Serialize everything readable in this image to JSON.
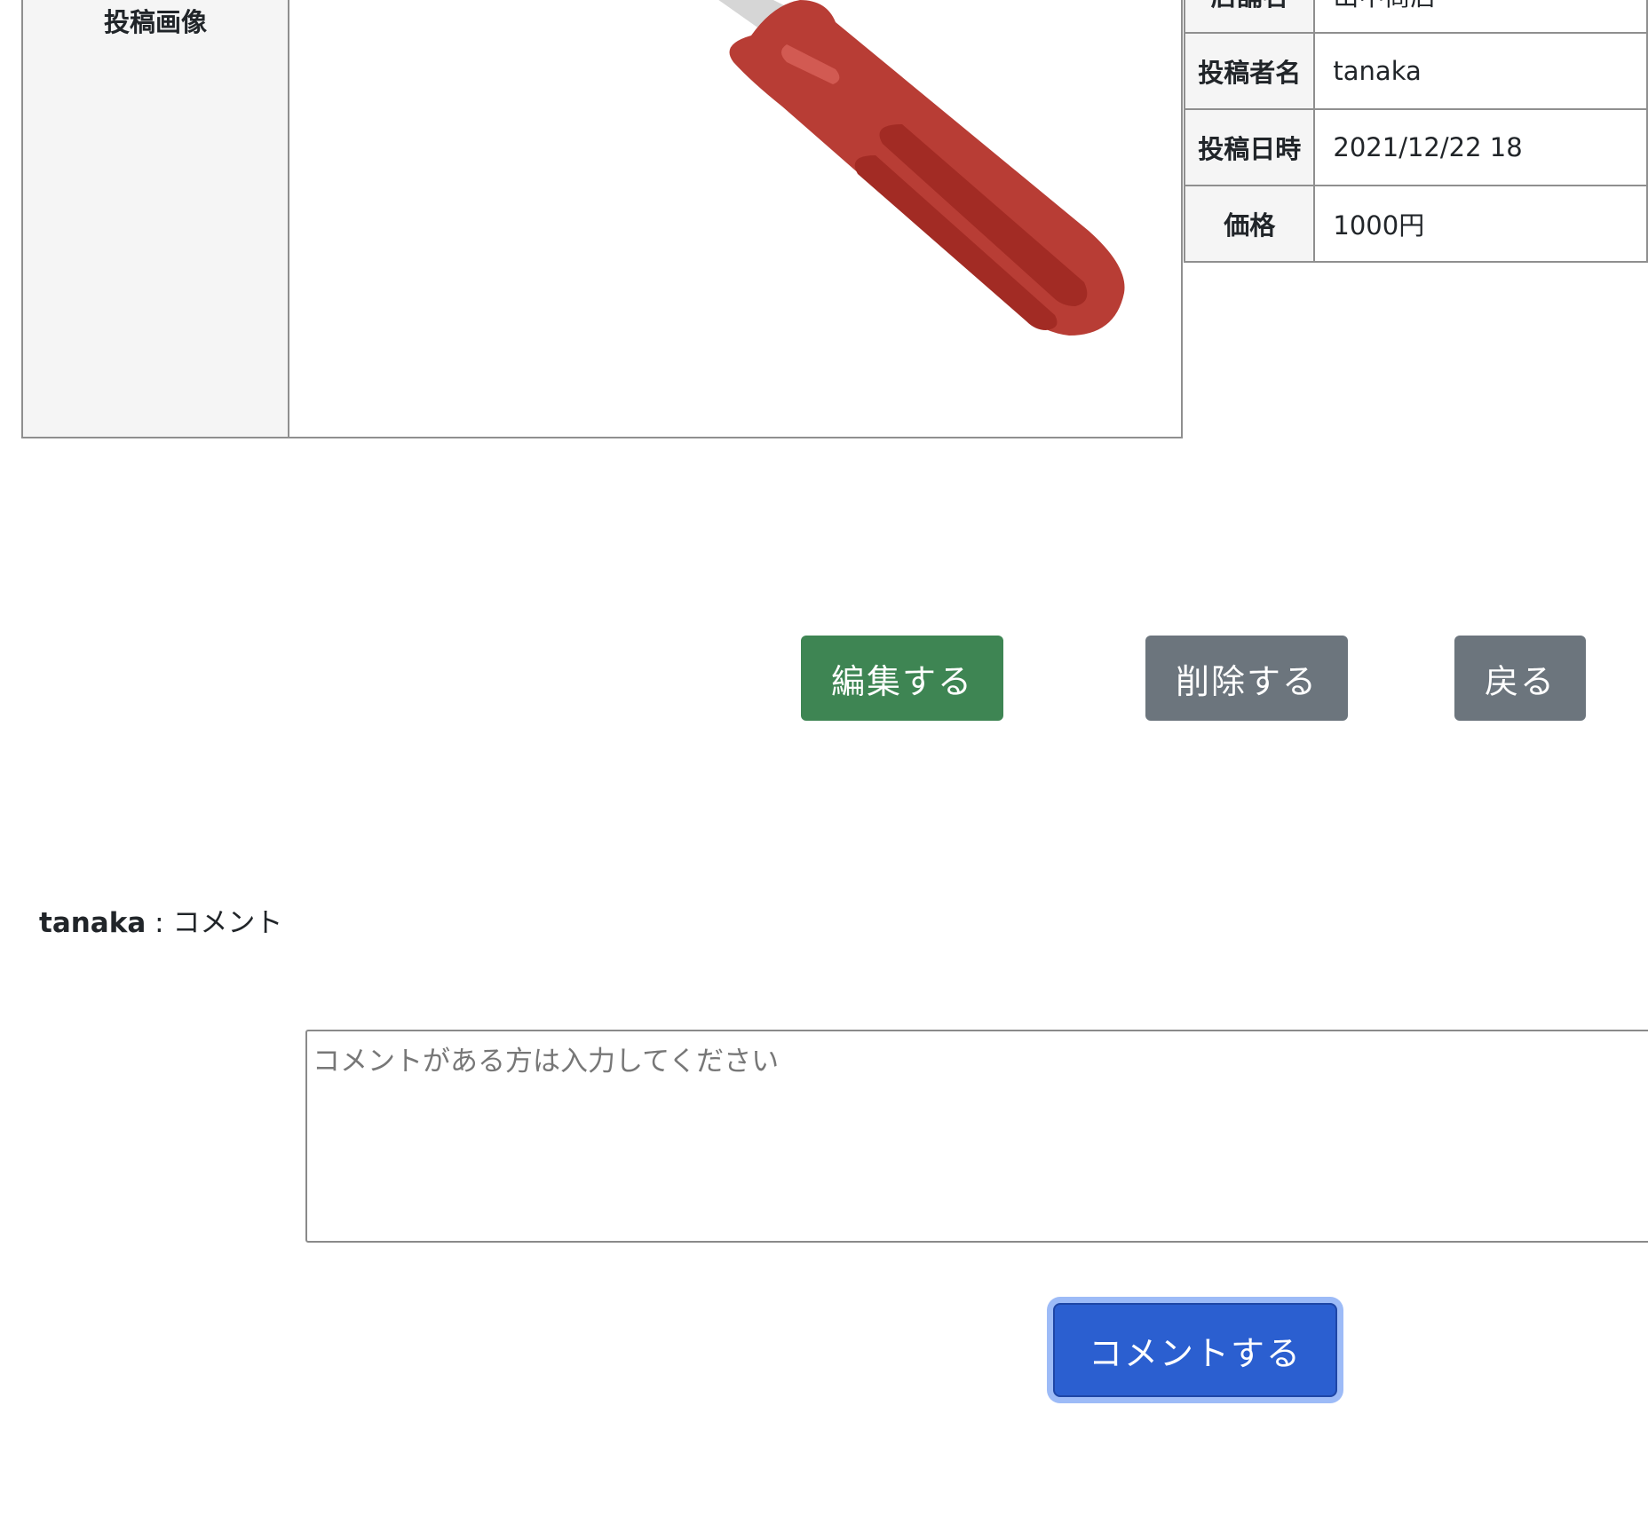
{
  "image_table": {
    "header": "投稿画像",
    "image_icon": "screwdriver-image"
  },
  "info_table": {
    "rows": [
      {
        "label": "店舗名",
        "value": "山中商店"
      },
      {
        "label": "投稿者名",
        "value": "tanaka"
      },
      {
        "label": "投稿日時",
        "value": "2021/12/22 18"
      },
      {
        "label": "価格",
        "value": "1000円"
      }
    ]
  },
  "actions": {
    "edit_label": "編集する",
    "delete_label": "削除する",
    "back_label": "戻る"
  },
  "comments": [
    {
      "user": "tanaka",
      "separator": " : ",
      "text": "コメント"
    }
  ],
  "comment_form": {
    "placeholder": "コメントがある方は入力してください",
    "submit_label": "コメントする"
  },
  "colors": {
    "edit": "#3e8553",
    "secondary": "#6c757d",
    "primary": "#2b5fd0",
    "handle": "#b83d35"
  }
}
